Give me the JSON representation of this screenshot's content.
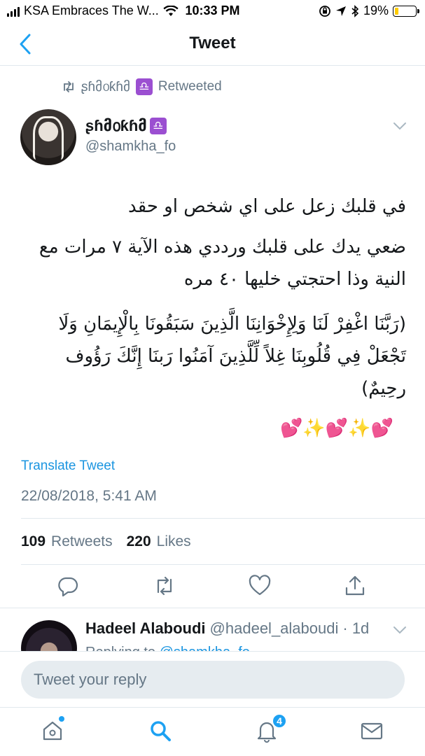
{
  "status_bar": {
    "carrier": "KSA Embraces The W...",
    "time": "10:33 PM",
    "battery": "19%",
    "battery_level": 0.19
  },
  "nav": {
    "back_icon": "chevron-left-icon",
    "title": "Tweet"
  },
  "tweet": {
    "retweeted_by": "ʂɦმ൦ƙɦმ",
    "retweet_label": "Retweeted",
    "zodiac": "♎",
    "author_name": "ʂɦმ൦ƙɦმ",
    "author_handle": "@shamkha_fo",
    "text_line1": "في قلبك زعل على اي شخص او حقد",
    "text_para2": "ضعي يدك على قلبك ورددي هذه الآية ٧ مرات مع النية وذا احتجتي خليها ٤٠ مره",
    "text_para3": "(رَبَّنَا اغْفِرْ لَنَا وَلِإِخْوَانِنَا الَّذِينَ سَبَقُونَا بِالْإِيمَانِ وَلَا تَجْعَلْ فِي قُلُوبِنَا غِلاً لِّلَّذِينَ آمَنُوا رَبنَا إِنَّكَ رَؤُوف رحِيمٌ)",
    "emojis": "💕✨💕✨💕",
    "translate_label": "Translate Tweet",
    "timestamp": "22/08/2018, 5:41 AM",
    "retweets_count": "109",
    "retweets_label": "Retweets",
    "likes_count": "220",
    "likes_label": "Likes"
  },
  "actions": [
    "reply-icon",
    "retweet-icon",
    "like-icon",
    "share-icon"
  ],
  "reply_preview": {
    "name": "Hadeel Alaboudi",
    "handle": "@hadeel_alaboudi",
    "age": "· 1d",
    "replying_prefix": "Replying to",
    "replying_mention": "@shamkha_fo"
  },
  "composer": {
    "placeholder": "Tweet your reply"
  },
  "tabbar": {
    "items": [
      "home-icon",
      "search-icon",
      "notifications-icon",
      "messages-icon"
    ],
    "notifications_badge": "4"
  },
  "colors": {
    "accent": "#1da1f2",
    "link": "#1b95e0",
    "secondary_text": "#657786",
    "divider": "#e1e8ed"
  }
}
